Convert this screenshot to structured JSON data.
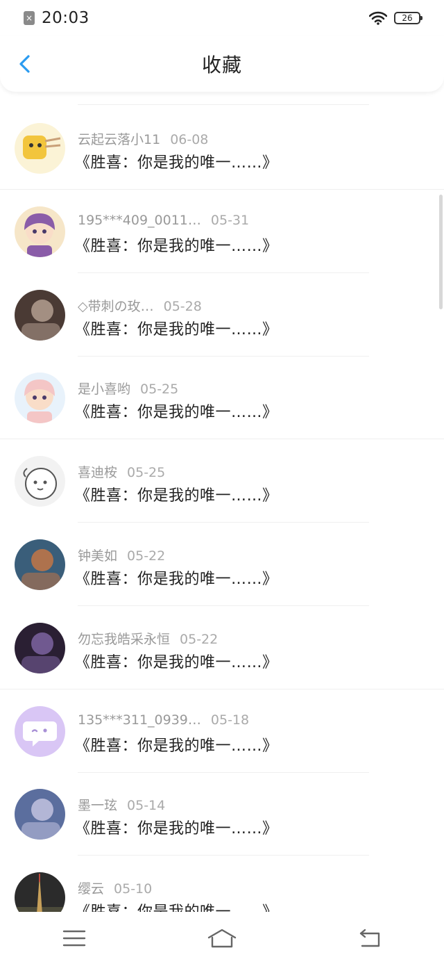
{
  "status": {
    "time": "20:03",
    "battery": "26",
    "sim_icon": "sim-disabled-icon",
    "wifi_icon": "wifi-icon"
  },
  "header": {
    "title": "收藏",
    "back_icon": "chevron-left-icon",
    "accent": "#2a9bf0"
  },
  "items": [
    {
      "name": "云起云落小11",
      "date": "06-08",
      "text": "《胜喜：你是我的唯一……》",
      "avatar": {
        "bg": "#fbf3d6",
        "fg": "#f2c53d",
        "style": "doodle"
      }
    },
    {
      "name": "195***409_0011…",
      "date": "05-31",
      "text": "《胜喜：你是我的唯一……》",
      "avatar": {
        "bg": "#f6e6c8",
        "fg": "#8a5ca8",
        "style": "girl"
      }
    },
    {
      "name": "◇带刺の玫…",
      "date": "05-28",
      "text": "《胜喜：你是我的唯一……》",
      "avatar": {
        "bg": "#4a3a34",
        "fg": "#c9b4a4",
        "style": "photo"
      }
    },
    {
      "name": "是小喜哟",
      "date": "05-25",
      "text": "《胜喜：你是我的唯一……》",
      "avatar": {
        "bg": "#e8f2fb",
        "fg": "#f4c6c6",
        "style": "girl"
      }
    },
    {
      "name": "喜迪桉",
      "date": "05-25",
      "text": "《胜喜：你是我的唯一……》",
      "avatar": {
        "bg": "#f2f2f2",
        "fg": "#555555",
        "style": "sheep"
      }
    },
    {
      "name": "钟美如",
      "date": "05-22",
      "text": "《胜喜：你是我的唯一……》",
      "avatar": {
        "bg": "#3a5e7a",
        "fg": "#e07a3a",
        "style": "photo"
      }
    },
    {
      "name": "勿忘我皓采永恒",
      "date": "05-22",
      "text": "《胜喜：你是我的唯一……》",
      "avatar": {
        "bg": "#2a1f33",
        "fg": "#8f72b8",
        "style": "photo"
      }
    },
    {
      "name": "135***311_0939…",
      "date": "05-18",
      "text": "《胜喜：你是我的唯一……》",
      "avatar": {
        "bg": "#d9c6f5",
        "fg": "#ffffff",
        "style": "chat"
      }
    },
    {
      "name": "墨一玹",
      "date": "05-14",
      "text": "《胜喜：你是我的唯一……》",
      "avatar": {
        "bg": "#5b6e9e",
        "fg": "#d8d4ee",
        "style": "photo"
      }
    },
    {
      "name": "缨云",
      "date": "05-10",
      "text": "《胜喜：你是我的唯一……》",
      "avatar": {
        "bg": "#2b2b2b",
        "fg": "#c7a05a",
        "style": "tower"
      }
    }
  ],
  "navbar": {
    "menu_icon": "menu-icon",
    "home_icon": "home-icon",
    "back_icon": "return-icon"
  }
}
